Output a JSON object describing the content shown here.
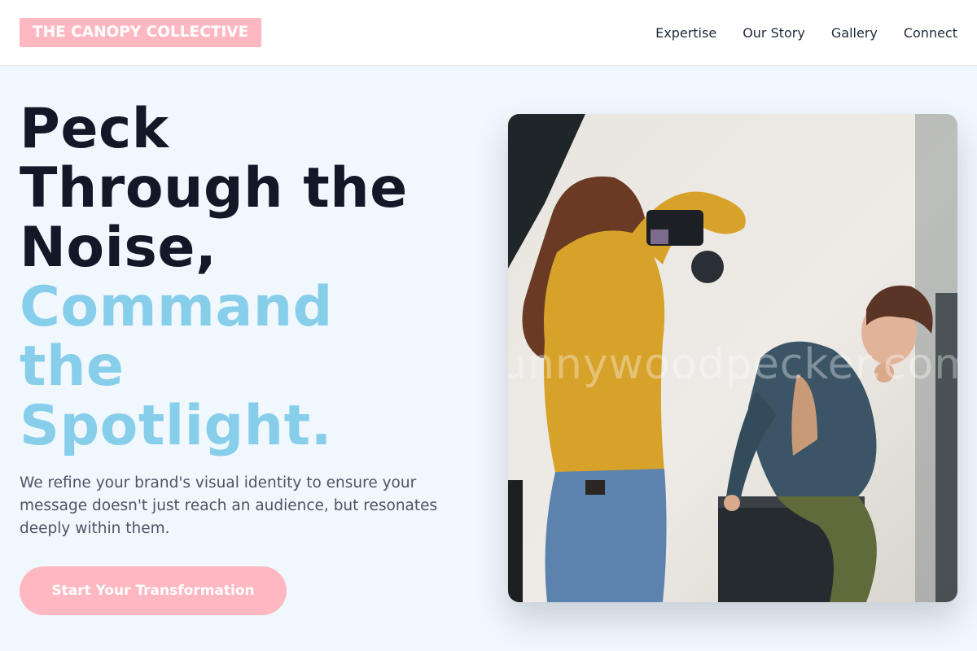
{
  "brand": {
    "name": "THE CANOPY COLLECTIVE"
  },
  "nav": {
    "items": [
      {
        "label": "Expertise"
      },
      {
        "label": "Our Story"
      },
      {
        "label": "Gallery"
      },
      {
        "label": "Connect"
      }
    ]
  },
  "hero": {
    "headline_lines": [
      "Peck",
      "Through the",
      "Noise,"
    ],
    "accent_lines": [
      "Command",
      "the",
      "Spotlight."
    ],
    "subtext": "We refine your brand's visual identity to ensure your message doesn't just reach an audience, but resonates deeply within them.",
    "cta_label": "Start Your Transformation"
  },
  "image": {
    "watermark": "unnywoodpecker.com"
  },
  "colors": {
    "accent": "#87ceeb",
    "brand_pink": "#ffb7c1",
    "headline": "#111827",
    "background": "#f0f7fd"
  }
}
